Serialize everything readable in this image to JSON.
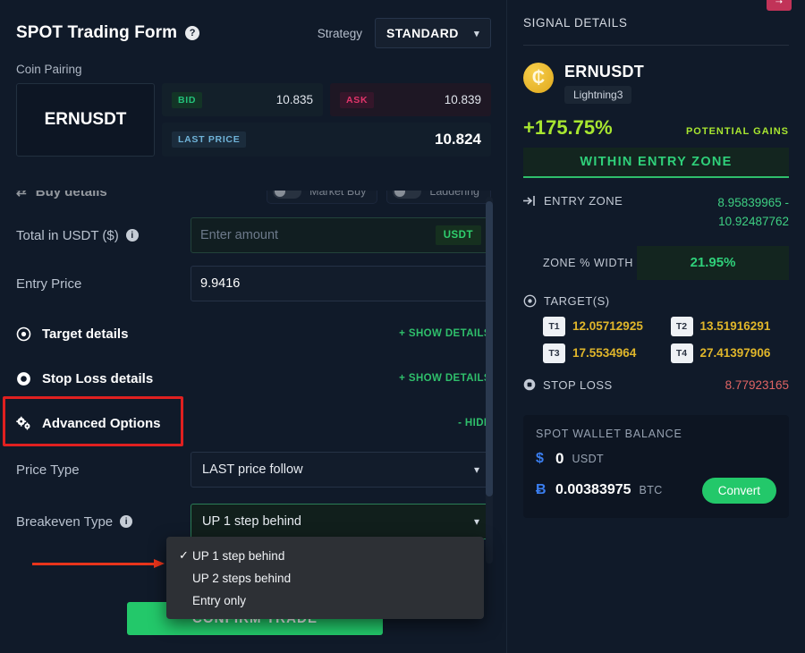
{
  "left": {
    "form_title": "SPOT Trading Form",
    "help_icon": "question-mark-icon",
    "strategy_label": "Strategy",
    "strategy_value": "STANDARD",
    "coin_pairing_label": "Coin Pairing",
    "pair_symbol": "ERNUSDT",
    "quotes": {
      "bid_label": "BID",
      "bid_value": "10.835",
      "ask_label": "ASK",
      "ask_value": "10.839",
      "last_label": "LAST PRICE",
      "last_value": "10.824"
    },
    "buy_details": {
      "title": "Buy details",
      "market_buy_label": "Market Buy",
      "laddering_label": "Laddering"
    },
    "total_field": {
      "label": "Total in USDT ($)",
      "placeholder": "Enter amount",
      "value": "",
      "suffix": "USDT"
    },
    "entry_price_field": {
      "label": "Entry Price",
      "value": "9.9416"
    },
    "target_section": {
      "title": "Target details",
      "link": "+ SHOW DETAILS"
    },
    "stoploss_section": {
      "title": "Stop Loss details",
      "link": "+ SHOW DETAILS"
    },
    "advanced_section": {
      "title": "Advanced Options",
      "link": "- HIDE"
    },
    "price_type": {
      "label": "Price Type",
      "value": "LAST price follow"
    },
    "breakeven_type": {
      "label": "Breakeven Type",
      "value": "UP 1 step behind"
    },
    "dropdown_options": [
      {
        "label": "UP 1 step behind",
        "selected": true
      },
      {
        "label": "UP 2 steps behind",
        "selected": false
      },
      {
        "label": "Entry only",
        "selected": false
      }
    ],
    "confirm_button": "CONFIRM TRADE"
  },
  "right": {
    "panel_title": "SIGNAL DETAILS",
    "coin_name": "ERNUSDT",
    "coin_tag": "Lightning3",
    "gains_value": "+175.75%",
    "gains_label": "POTENTIAL GAINS",
    "status_banner": "WITHIN ENTRY ZONE",
    "entry_zone_label": "ENTRY ZONE",
    "entry_zone_line1": "8.95839965 -",
    "entry_zone_line2": "10.92487762",
    "zone_width_label": "ZONE % WIDTH",
    "zone_width_value": "21.95%",
    "targets_label": "TARGET(S)",
    "targets": [
      {
        "tag": "T1",
        "value": "12.05712925"
      },
      {
        "tag": "T2",
        "value": "13.51916291"
      },
      {
        "tag": "T3",
        "value": "17.5534964"
      },
      {
        "tag": "T4",
        "value": "27.41397906"
      }
    ],
    "stoploss_label": "STOP LOSS",
    "stoploss_value": "8.77923165",
    "wallet": {
      "title": "SPOT WALLET BALANCE",
      "usdt_symbol": "$",
      "usdt_amount": "0",
      "usdt_unit": "USDT",
      "btc_symbol": "Ƀ",
      "btc_amount": "0.00383975",
      "btc_unit": "BTC",
      "convert_label": "Convert"
    }
  },
  "colors": {
    "accent_green": "#23c86a",
    "gains_green": "#a8e630",
    "target_gold": "#e0b62a",
    "stoploss_red": "#e06464",
    "annotation_red": "#e02020",
    "panel_bg": "#101a29"
  }
}
